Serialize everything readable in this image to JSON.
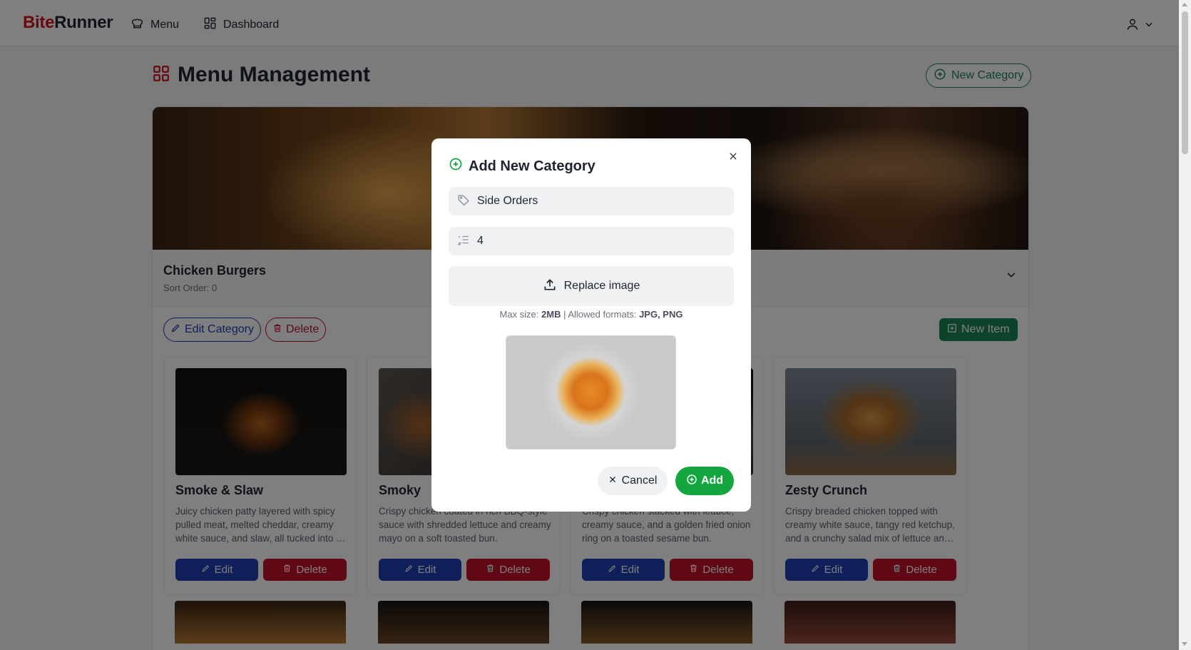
{
  "navbar": {
    "brand_part1": "Bite",
    "brand_part2": "Runner",
    "menu_link": "Menu",
    "dashboard_link": "Dashboard"
  },
  "page": {
    "title": "Menu Management",
    "new_category_button": "New Category"
  },
  "category": {
    "name": "Chicken Burgers",
    "sort_order": "Sort Order: 0",
    "edit_button": "Edit Category",
    "delete_button": "Delete",
    "new_item_button": "New Item"
  },
  "items": [
    {
      "name": "Smoke & Slaw",
      "description": "Juicy chicken patty layered with spicy pulled meat, melted cheddar, creamy white sauce, and slaw, all tucked into a soft toasted bun.",
      "edit": "Edit",
      "delete": "Delete"
    },
    {
      "name": "Smoky",
      "description": "Crispy chicken coated in rich BBQ-style sauce with shredded lettuce and creamy mayo on a soft toasted bun.",
      "edit": "Edit",
      "delete": "Delete"
    },
    {
      "name": "",
      "description": "Crispy chicken stacked with lettuce, creamy sauce, and a golden fried onion ring on a toasted sesame bun.",
      "edit": "Edit",
      "delete": "Delete"
    },
    {
      "name": "Zesty Crunch",
      "description": "Crispy breaded chicken topped with creamy white sauce, tangy red ketchup, and a crunchy salad mix of lettuce and more.",
      "edit": "Edit",
      "delete": "Delete"
    }
  ],
  "modal": {
    "title": "Add New Category",
    "name_value": "Side Orders",
    "sort_value": "4",
    "upload_label": "Replace image",
    "hint_prefix": "Max size: ",
    "hint_size": "2MB",
    "hint_mid": " | Allowed formats: ",
    "hint_formats": "JPG, PNG",
    "cancel_button": "Cancel",
    "add_button": "Add"
  },
  "colors": {
    "brand_red": "#d0101f",
    "primary_green": "#198754",
    "add_green": "#13a63f",
    "edit_blue": "#1f3fb4",
    "delete_red": "#c2102b"
  }
}
